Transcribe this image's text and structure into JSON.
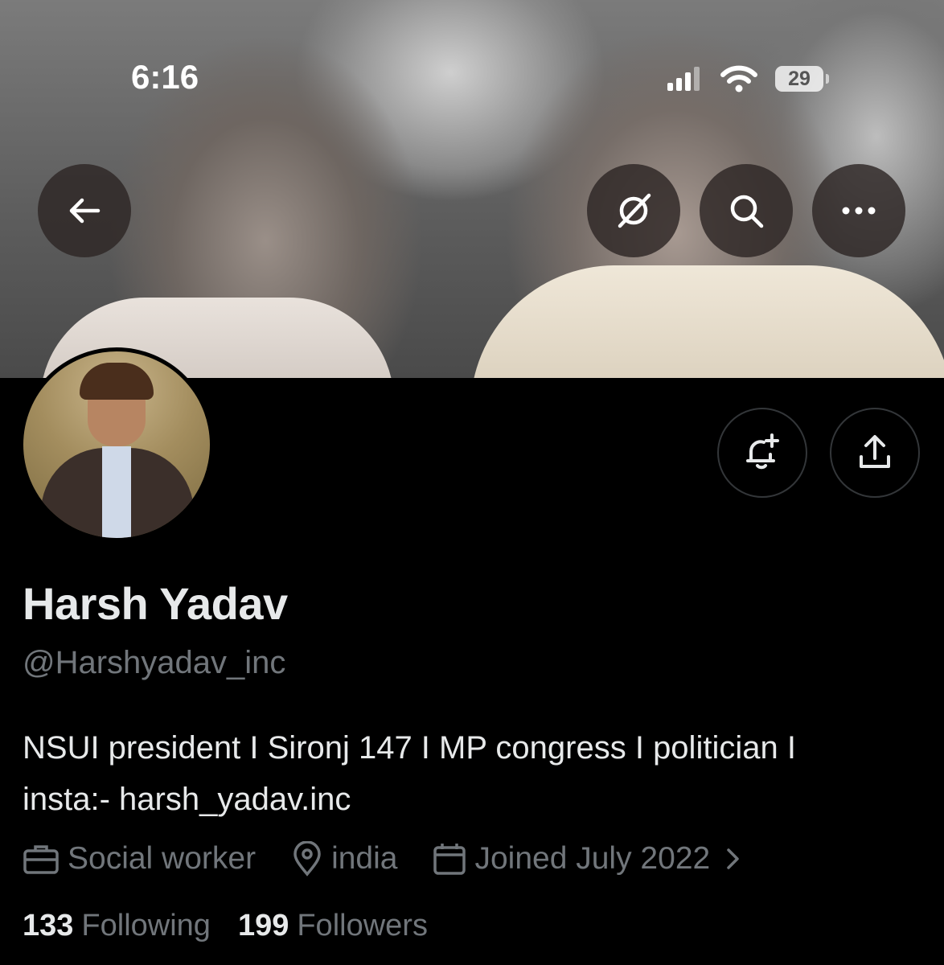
{
  "status_bar": {
    "time": "6:16",
    "battery": "29"
  },
  "header": {
    "back_icon": "arrow-left-icon",
    "translate_icon": "grok-slash-icon",
    "search_icon": "search-icon",
    "more_icon": "more-icon"
  },
  "profile": {
    "name": "Harsh Yadav",
    "handle": "@Harshyadav_inc",
    "bio_line1": "NSUI president I Sironj 147 I MP congress I politician I",
    "bio_line2": "insta:- harsh_yadav.inc",
    "profession": "Social worker",
    "location": "india",
    "joined": "Joined July 2022",
    "following_count": "133",
    "following_label": "Following",
    "followers_count": "199",
    "followers_label": "Followers"
  },
  "actions": {
    "notify_icon": "bell-plus-icon",
    "share_icon": "share-icon"
  }
}
